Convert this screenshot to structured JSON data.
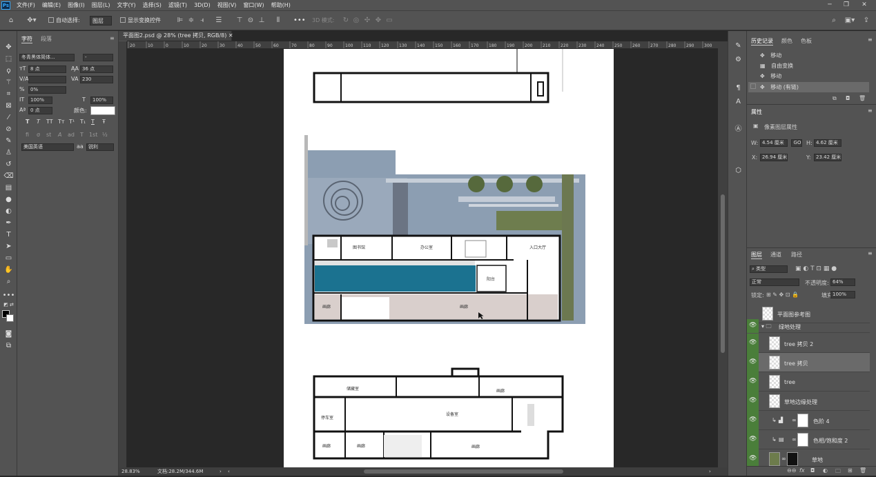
{
  "menu": [
    "文件(F)",
    "编辑(E)",
    "图像(I)",
    "图层(L)",
    "文字(Y)",
    "选择(S)",
    "滤镜(T)",
    "3D(D)",
    "视图(V)",
    "窗口(W)",
    "帮助(H)"
  ],
  "app_logo": "Ps",
  "options_bar": {
    "auto_select_label": "自动选择:",
    "auto_select_value": "图层",
    "show_transform_label": "显示变换控件",
    "mode_3d_label": "3D 模式:",
    "more": "•••"
  },
  "character_panel": {
    "tabs": [
      "字符",
      "段落"
    ],
    "font_family": "冬青黑体简体...",
    "font_style": "-",
    "font_size": "8 点",
    "leading": "36 点",
    "kerning": "",
    "tracking": "230",
    "scale_percent": "0%",
    "vertical_scale": "100%",
    "horizontal_scale": "100%",
    "baseline": "0 点",
    "color_label": "颜色:",
    "style_buttons": [
      "T",
      "T",
      "TT",
      "Tт",
      "T¹",
      "T₁",
      "T",
      "Ŧ"
    ],
    "ot_buttons": [
      "fi",
      "σ",
      "st",
      "A",
      "ad",
      "T",
      "1st",
      "½"
    ],
    "language": "美国英语",
    "aa_label": "aa",
    "antialias": "锐利"
  },
  "document": {
    "tab_label": "平面图2.psd @ 28% (tree 拷贝, RGB/8)",
    "ruler_marks": [
      "20",
      "10",
      "0",
      "10",
      "20",
      "30",
      "40",
      "50",
      "60",
      "70",
      "80",
      "90",
      "100",
      "110",
      "120",
      "130",
      "140",
      "150",
      "160",
      "170",
      "180",
      "190",
      "200",
      "210",
      "220",
      "230",
      "240",
      "250",
      "260",
      "270",
      "280",
      "290",
      "300"
    ],
    "rooms": {
      "library": "图书馆",
      "office": "办公室",
      "entrance": "入口大厅",
      "balcony": "阳台",
      "gallery": "画廊",
      "storage": "储藏室",
      "equipment": "设备室",
      "parking": "停车室"
    }
  },
  "status_bar": {
    "zoom": "28.83%",
    "doc_size": "文档:28.2M/344.6M"
  },
  "history_panel": {
    "tabs": [
      "历史记录",
      "颜色",
      "色板"
    ],
    "items": [
      {
        "label": "移动",
        "icon": "move-icon"
      },
      {
        "label": "自由变换",
        "icon": "transform-icon"
      },
      {
        "label": "移动",
        "icon": "move-icon"
      },
      {
        "label": "移动 (有链)",
        "icon": "move-icon"
      }
    ]
  },
  "properties_panel": {
    "title": "属性",
    "type_label": "像素图层属性",
    "w_label": "W:",
    "w_value": "4.54 厘米",
    "h_label": "H:",
    "h_value": "4.62 厘米",
    "x_label": "X:",
    "x_value": "26.94 厘米",
    "y_label": "Y:",
    "y_value": "23.42 厘米",
    "link_label": "GO"
  },
  "layers_panel": {
    "tabs": [
      "图层",
      "通道",
      "路径"
    ],
    "filter": "类型",
    "blend_mode": "正常",
    "opacity_label": "不透明度:",
    "opacity_value": "64%",
    "lock_label": "锁定:",
    "fill_label": "填充:",
    "fill_value": "100%",
    "layers": [
      {
        "name": "平面图参考图",
        "visible": false
      },
      {
        "name": "绿地处理",
        "visible": true,
        "group": true
      },
      {
        "name": "tree 拷贝 2",
        "visible": true
      },
      {
        "name": "tree 拷贝",
        "visible": true,
        "selected": true
      },
      {
        "name": "tree",
        "visible": true
      },
      {
        "name": "草地边缘处理",
        "visible": true
      },
      {
        "name": "色阶 4",
        "visible": true
      },
      {
        "name": "色相/饱和度 2",
        "visible": true
      },
      {
        "name": "草地",
        "visible": true
      }
    ]
  },
  "colors": {
    "ui_bg": "#535353",
    "canvas_bg": "#282828",
    "visible_eye": "#4a7e3a",
    "selected_layer": "#6a6a6a",
    "pool": "#1b7290"
  }
}
